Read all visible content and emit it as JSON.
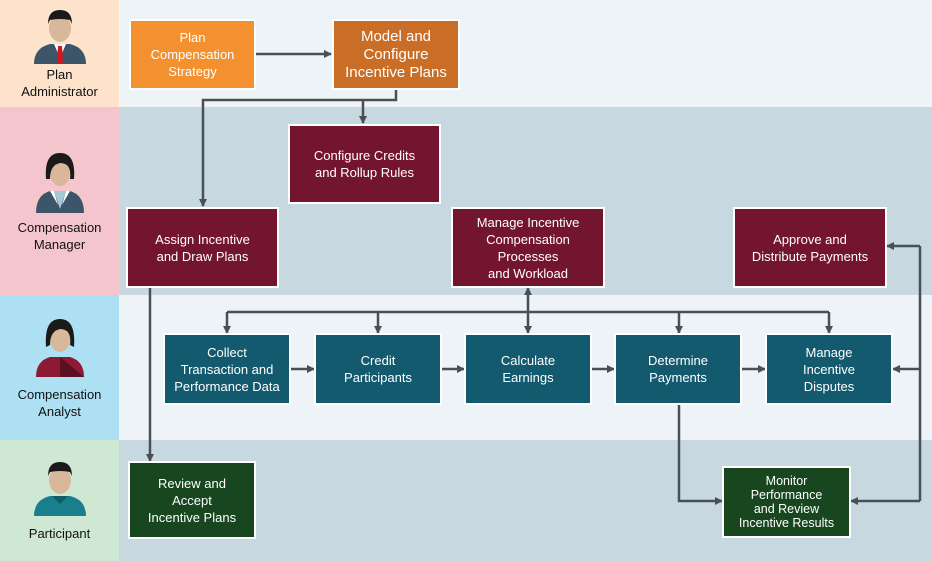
{
  "lanes": [
    {
      "role": "Plan\nAdministrator",
      "role_color": "#fde3cb",
      "bg": "#eef3f7"
    },
    {
      "role": "Compensation\nManager",
      "role_color": "#f4c5cd",
      "bg": "#c8d8e0"
    },
    {
      "role": "Compensation\nAnalyst",
      "role_color": "#aee0f3",
      "bg": "#eef3f7"
    },
    {
      "role": "Participant",
      "role_color": "#cfe8d3",
      "bg": "#c8d8e0"
    }
  ],
  "boxes": {
    "plan_strategy": "Plan\nCompensation\nStrategy",
    "model_configure": "Model and\nConfigure\nIncentive Plans",
    "configure_credits": "Configure Credits\nand Rollup Rules",
    "assign_plans": "Assign Incentive\nand Draw Plans",
    "manage_processes": "Manage Incentive\nCompensation\nProcesses\nand Workload",
    "approve_payments": "Approve and\nDistribute Payments",
    "collect_data": "Collect\nTransaction and\nPerformance Data",
    "credit_participants": "Credit\nParticipants",
    "calculate_earnings": "Calculate\nEarnings",
    "determine_payments": "Determine\nPayments",
    "manage_disputes": "Manage\nIncentive\nDisputes",
    "review_accept": "Review and\nAccept\nIncentive Plans",
    "monitor_performance": "Monitor\nPerformance\nand Review\nIncentive Results"
  },
  "colors": {
    "orange": "#f39030",
    "rust": "#c96d27",
    "maroon": "#74152f",
    "teal": "#135a6e",
    "green": "#17461f",
    "arrow": "#4a4f54"
  }
}
